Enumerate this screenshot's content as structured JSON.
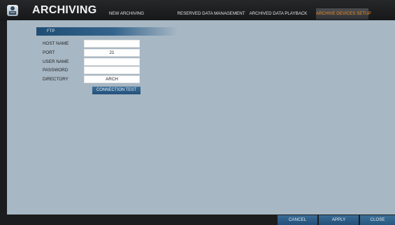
{
  "header": {
    "title": "ARCHIVING",
    "tabs": [
      {
        "label": "NEW ARCHIVING"
      },
      {
        "label": "RESERVED DATA MANAGEMENT"
      },
      {
        "label": "ARCHIVED DATA PLAYBACK"
      },
      {
        "label": "ARCHIVE DEVICES SETUP",
        "active": true
      }
    ]
  },
  "ftp": {
    "section_title": "FTP",
    "fields": [
      {
        "label": "HOST NAME",
        "value": ""
      },
      {
        "label": "PORT",
        "value": "21"
      },
      {
        "label": "USER NAME",
        "value": ""
      },
      {
        "label": "PASSWORD",
        "value": ""
      },
      {
        "label": "DIRECTORY",
        "value": "ARCH"
      }
    ],
    "connection_test_label": "CONNECTION TEST"
  },
  "footer": {
    "cancel_label": "CANCEL",
    "apply_label": "APPLY",
    "close_label": "CLOSE"
  },
  "colors": {
    "active_tab_text": "#f08b1e",
    "content_background": "#a7b7c4",
    "button_blue": "#2b5a82"
  },
  "icons": {
    "app_icon": "archive-device-icon"
  }
}
